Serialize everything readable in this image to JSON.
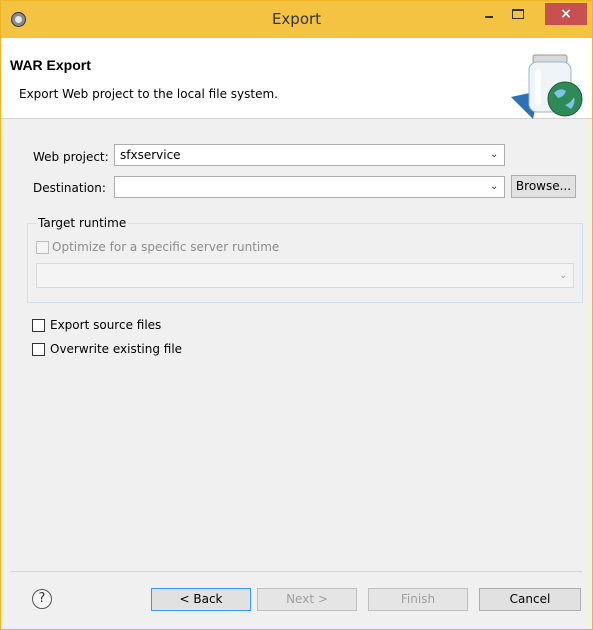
{
  "window": {
    "title": "Export",
    "close_glyph": "×"
  },
  "banner": {
    "title": "WAR Export",
    "description": "Export Web project to the local file system.",
    "icon": "war-export-jar-globe-icon"
  },
  "form": {
    "web_project_label": "Web project:",
    "web_project_value": "sfxservice",
    "destination_label": "Destination:",
    "destination_value": "",
    "browse_label": "Browse..."
  },
  "target_runtime": {
    "legend": "Target runtime",
    "optimize_label": "Optimize for a specific server runtime",
    "optimize_checked": false,
    "runtime_value": ""
  },
  "options": {
    "export_source_label": "Export source files",
    "export_source_checked": false,
    "overwrite_label": "Overwrite existing file",
    "overwrite_checked": false
  },
  "footer": {
    "help_glyph": "?",
    "back_label": "< Back",
    "next_label": "Next >",
    "finish_label": "Finish",
    "cancel_label": "Cancel"
  },
  "colors": {
    "titlebar": "#f4c341",
    "close_button": "#c75050",
    "dialog_background": "#f0f0f0"
  }
}
